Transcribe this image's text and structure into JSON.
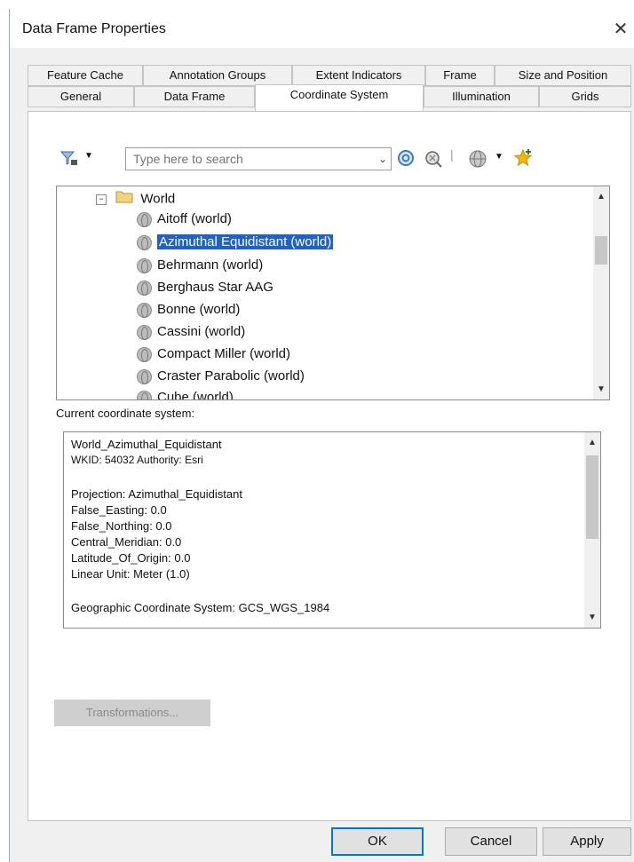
{
  "window": {
    "title": "Data Frame Properties",
    "close_glyph": "✕"
  },
  "tabs_row1": [
    "Feature Cache",
    "Annotation Groups",
    "Extent Indicators",
    "Frame",
    "Size and Position"
  ],
  "tabs_row2": [
    "General",
    "Data Frame",
    "Coordinate System",
    "Illumination",
    "Grids"
  ],
  "active_tab": "Coordinate System",
  "search": {
    "placeholder": "Type here to search"
  },
  "tree": {
    "folder": "World",
    "items": [
      "Aitoff (world)",
      "Azimuthal Equidistant (world)",
      "Behrmann (world)",
      "Berghaus Star AAG",
      "Bonne (world)",
      "Cassini (world)",
      "Compact Miller (world)",
      "Craster Parabolic (world)",
      "Cube (world)"
    ],
    "selected_index": 1
  },
  "current_label": "Current coordinate system:",
  "info": {
    "name": "World_Azimuthal_Equidistant",
    "wkid": "WKID: 54032 Authority: Esri",
    "projection": "Projection: Azimuthal_Equidistant",
    "false_easting": "False_Easting: 0.0",
    "false_northing": "False_Northing: 0.0",
    "central_meridian": "Central_Meridian: 0.0",
    "latitude_of_origin": "Latitude_Of_Origin: 0.0",
    "linear_unit": "Linear Unit: Meter (1.0)",
    "geographic": "Geographic Coordinate System: GCS_WGS_1984"
  },
  "buttons": {
    "transformations": "Transformations...",
    "ok": "OK",
    "cancel": "Cancel",
    "apply": "Apply"
  },
  "icons": [
    "filter-icon",
    "dropdown-arrow-icon",
    "search-icon",
    "clear-search-icon",
    "globe-add-icon",
    "favorite-star-icon",
    "folder-icon",
    "collapse-icon",
    "globe-icon"
  ]
}
